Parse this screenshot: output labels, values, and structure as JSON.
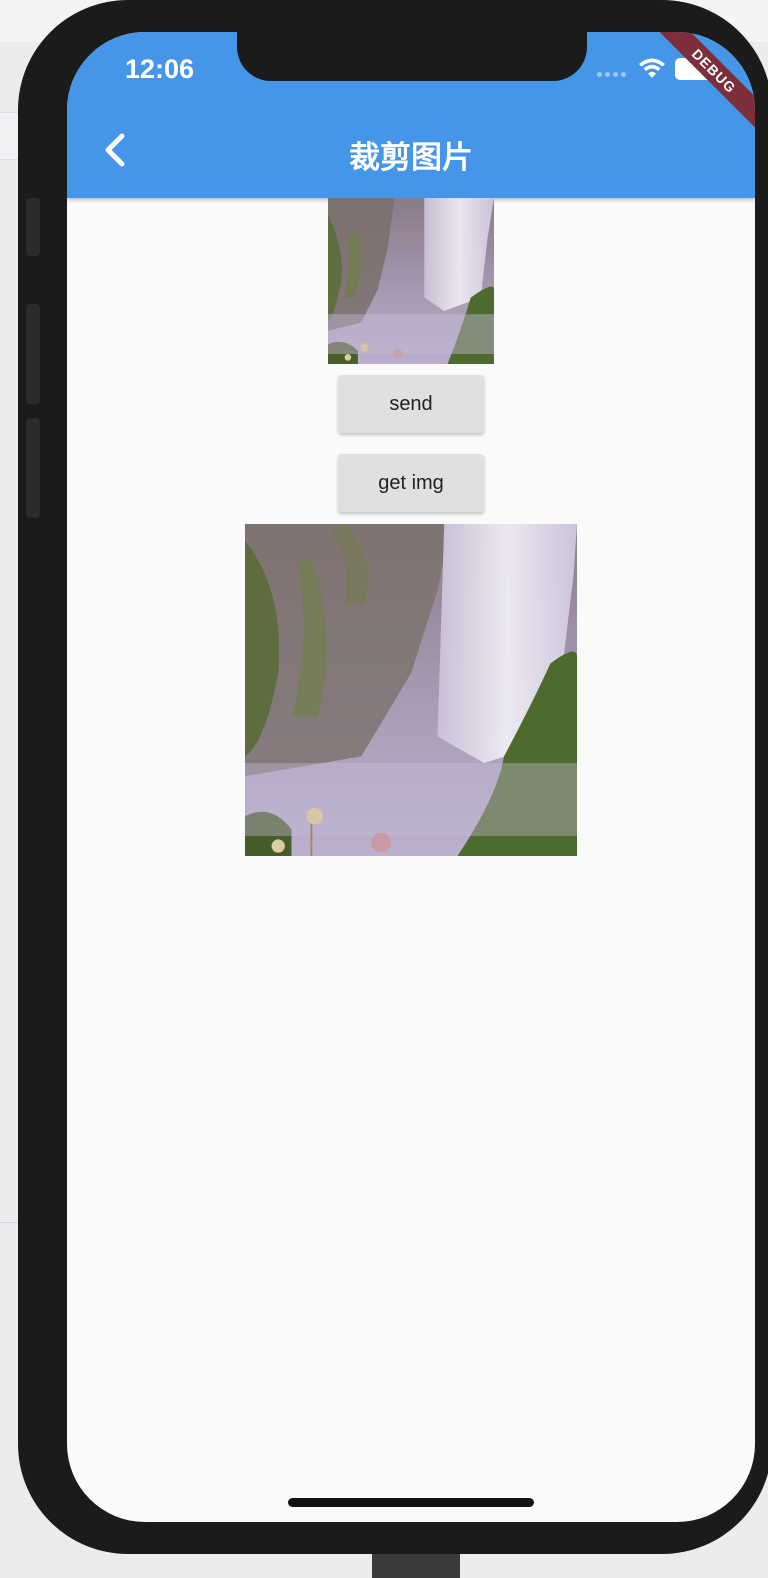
{
  "status_bar": {
    "time": "12:06",
    "icons": [
      "signal-icon",
      "wifi-icon",
      "battery-icon"
    ],
    "debug_banner": "DEBUG"
  },
  "app_bar": {
    "title": "裁剪图片",
    "back_icon": "chevron-left-icon",
    "color": "#4596e9"
  },
  "content": {
    "cropped_image": "waterfall-photo",
    "send_label": "send",
    "get_img_label": "get img",
    "result_image": "waterfall-photo"
  },
  "colors": {
    "accent": "#4596e9",
    "button_bg": "#e0e0e0",
    "screen_bg": "#fafafa",
    "debug_ribbon": "#7d2e3a"
  }
}
